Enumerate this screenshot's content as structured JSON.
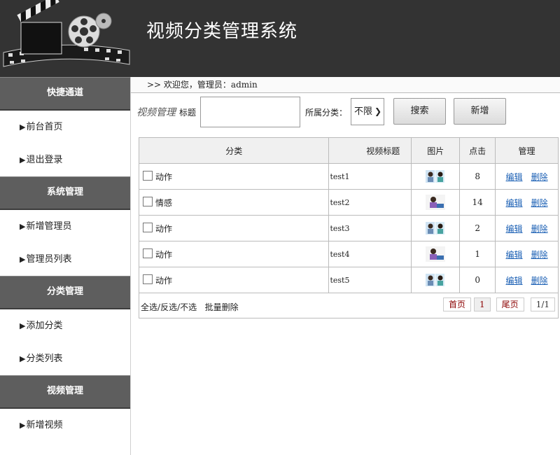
{
  "header": {
    "title": "视频分类管理系统"
  },
  "welcome": {
    "text": ">> 欢迎您，管理员：admin"
  },
  "sidebar": {
    "sections": [
      {
        "title": "快捷通道",
        "items": [
          "前台首页",
          "退出登录"
        ]
      },
      {
        "title": "系统管理",
        "items": [
          "新增管理员",
          "管理员列表"
        ]
      },
      {
        "title": "分类管理",
        "items": [
          "添加分类",
          "分类列表"
        ]
      },
      {
        "title": "视频管理",
        "items": [
          "新增视频"
        ]
      }
    ]
  },
  "toolbar": {
    "section_title": "视频管理",
    "title_label": "标题",
    "title_value": "",
    "category_label": "所属分类：",
    "category_selected": "不限",
    "search_label": "搜索",
    "add_label": "新增"
  },
  "table": {
    "headers": {
      "category": "分类",
      "title": "视频标题",
      "image": "图片",
      "clicks": "点击",
      "manage": "管理"
    },
    "rows": [
      {
        "category": "动作",
        "title": "test1",
        "clicks": "8"
      },
      {
        "category": "情感",
        "title": "test2",
        "clicks": "14"
      },
      {
        "category": "动作",
        "title": "test3",
        "clicks": "2"
      },
      {
        "category": "动作",
        "title": "test4",
        "clicks": "1"
      },
      {
        "category": "动作",
        "title": "test5",
        "clicks": "0"
      }
    ],
    "edit_label": "编辑",
    "delete_label": "删除"
  },
  "footer": {
    "select_all": "全选",
    "invert": "反选",
    "select_none": "不选",
    "batch_delete": "批量删除",
    "first_page": "首页",
    "current_page": "1",
    "last_page": "尾页",
    "page_info": "1/1"
  }
}
